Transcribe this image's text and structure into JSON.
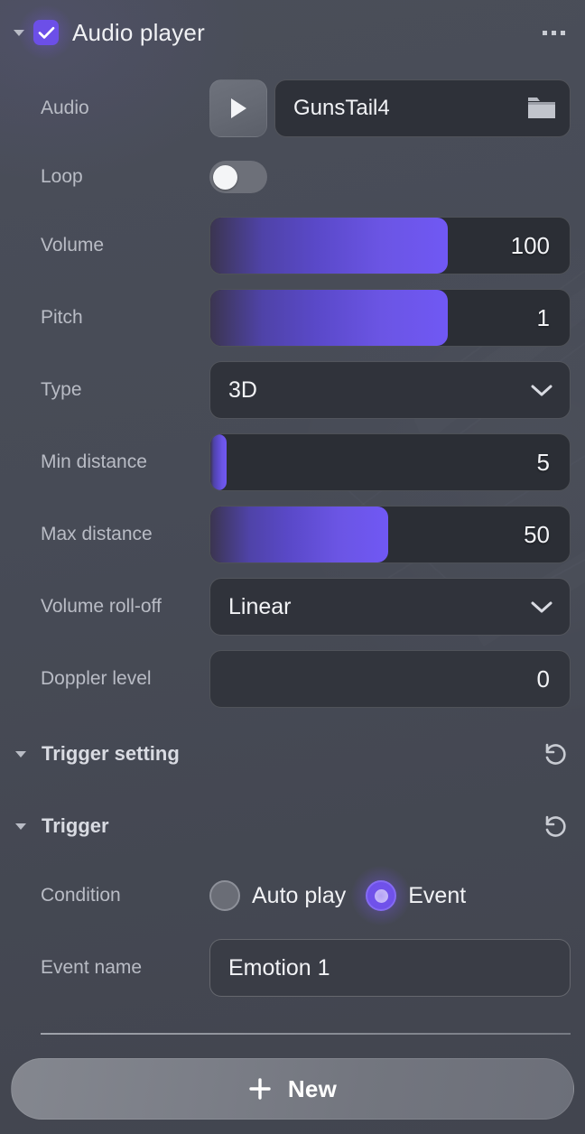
{
  "header": {
    "title": "Audio player",
    "checkbox_checked": true,
    "expanded": true,
    "menu_icon": "more-horizontal-icon"
  },
  "accent": {
    "purple": "#6c4fe8",
    "purple_light": "#7058f4",
    "panel_bg": "#474b56",
    "field_bg": "#2e3139"
  },
  "properties": {
    "audio": {
      "label": "Audio",
      "play_icon": "play-icon",
      "value": "GunsTail4",
      "browse_icon": "folder-icon"
    },
    "loop": {
      "label": "Loop",
      "enabled": false
    },
    "volume": {
      "label": "Volume",
      "value": "100",
      "fill_percent": 66
    },
    "pitch": {
      "label": "Pitch",
      "value": "1",
      "fill_percent": 66
    },
    "type": {
      "label": "Type",
      "value": "3D",
      "chevron_icon": "chevron-down-icon"
    },
    "min_distance": {
      "label": "Min distance",
      "value": "5",
      "fill_percent": 4.5
    },
    "max_distance": {
      "label": "Max distance",
      "value": "50",
      "fill_percent": 49.5
    },
    "volume_rolloff": {
      "label": "Volume roll-off",
      "value": "Linear",
      "chevron_icon": "chevron-down-icon"
    },
    "doppler_level": {
      "label": "Doppler level",
      "value": "0"
    }
  },
  "trigger_setting": {
    "title": "Trigger setting",
    "reset_icon": "reset-icon",
    "expanded": true
  },
  "trigger": {
    "title": "Trigger",
    "reset_icon": "reset-icon",
    "expanded": true,
    "condition": {
      "label": "Condition",
      "options": [
        {
          "label": "Auto play",
          "selected": false
        },
        {
          "label": "Event",
          "selected": true
        }
      ]
    },
    "event_name": {
      "label": "Event name",
      "value": "Emotion 1"
    }
  },
  "footer": {
    "new_label": "New",
    "plus_icon": "plus-icon"
  }
}
